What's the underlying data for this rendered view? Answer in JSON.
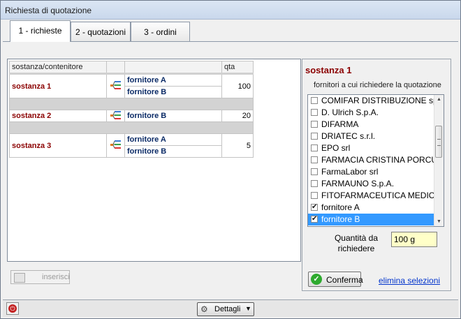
{
  "window": {
    "title": "Richiesta di quotazione"
  },
  "tabs": [
    {
      "label": "1 - richieste"
    },
    {
      "label": "2 - quotazioni"
    },
    {
      "label": "3 - ordini"
    }
  ],
  "grid": {
    "headers": {
      "name": "sostanza/contenitore",
      "qta": "qta"
    },
    "rows": [
      {
        "sostanza": "sostanza 1",
        "fornitori": [
          "fornitore A",
          "fornitore B"
        ],
        "qta": "100"
      },
      {
        "sostanza": "sostanza 2",
        "fornitori": [
          "fornitore B"
        ],
        "qta": "20"
      },
      {
        "sostanza": "sostanza 3",
        "fornitori": [
          "fornitore A",
          "fornitore B"
        ],
        "qta": "5"
      }
    ]
  },
  "insert_button": {
    "label": "inserisci"
  },
  "right_panel": {
    "title": "sostanza 1",
    "subtitle": "fornitori a cui richiedere la quotazione",
    "suppliers": [
      {
        "name": "COMIFAR DISTRIBUZIONE sp",
        "checked": false
      },
      {
        "name": "D. Ulrich S.p.A.",
        "checked": false
      },
      {
        "name": "DIFARMA",
        "checked": false
      },
      {
        "name": "DRIATEC s.r.l.",
        "checked": false
      },
      {
        "name": "EPO srl",
        "checked": false
      },
      {
        "name": "FARMACIA CRISTINA PORCU",
        "checked": false
      },
      {
        "name": "FarmaLabor srl",
        "checked": false
      },
      {
        "name": "FARMAUNO S.p.A.",
        "checked": false
      },
      {
        "name": "FITOFARMACEUTICA MEDICA",
        "checked": false
      },
      {
        "name": "fornitore A",
        "checked": true
      },
      {
        "name": "fornitore B",
        "checked": true,
        "selected": true
      }
    ],
    "quantity_label": "Quantità da richiedere",
    "quantity_value": "100 g",
    "confirm_label": "Conferma",
    "clear_link": "elimina selezioni"
  },
  "statusbar": {
    "details_label": "Dettagli"
  },
  "colors": {
    "accent_dark_red": "#8b0000",
    "selection_blue": "#3399ff",
    "link_blue": "#0033cc"
  }
}
